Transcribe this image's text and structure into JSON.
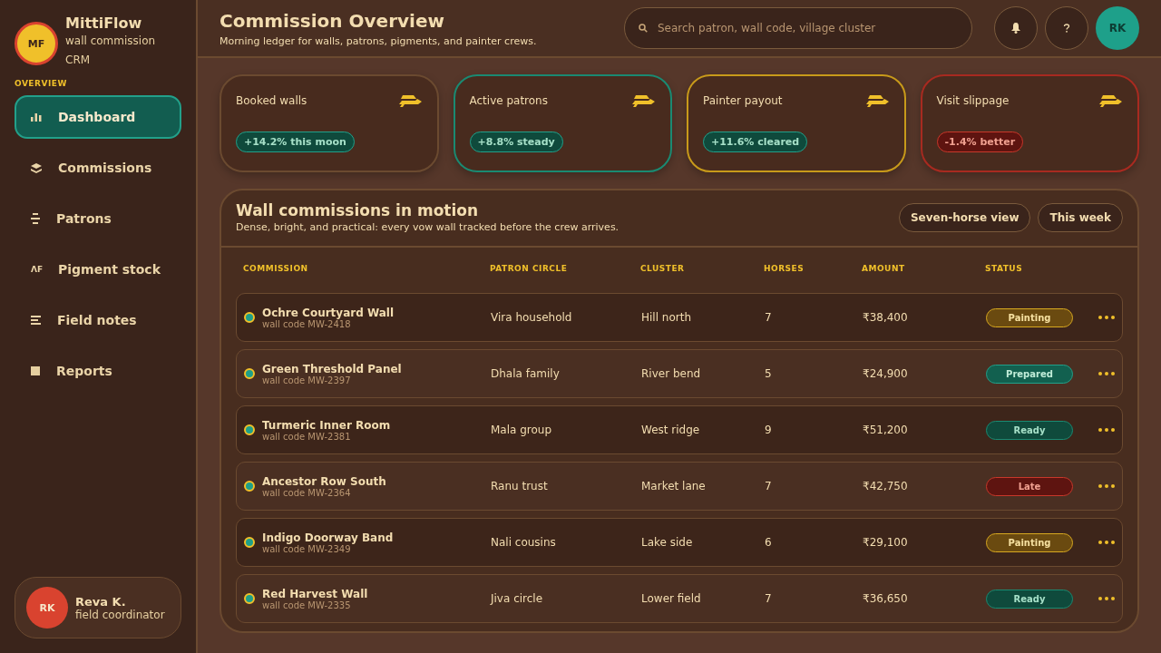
{
  "brand": {
    "initials": "MF",
    "name": "MittiFlow",
    "tagline": "wall commission CRM"
  },
  "sidebar": {
    "section": "OVERVIEW",
    "items": [
      {
        "label": "Dashboard",
        "kind": "bars",
        "selected": true
      },
      {
        "label": "Commissions",
        "kind": "layers",
        "selected": false
      },
      {
        "label": "Patrons",
        "kind": "stack",
        "selected": false
      },
      {
        "label": "Pigment stock",
        "kind": "text",
        "icon_text": "ΛF",
        "selected": false
      },
      {
        "label": "Field notes",
        "kind": "lines",
        "selected": false
      },
      {
        "label": "Reports",
        "kind": "square",
        "selected": false
      }
    ]
  },
  "user": {
    "initials": "RK",
    "name": "Reva K.",
    "role": "field coordinator"
  },
  "header": {
    "title": "Commission Overview",
    "subtitle": "Morning ledger for walls, patrons, pigments, and painter crews.",
    "search": {
      "placeholder": "Search patron, wall code, village cluster"
    },
    "avatar": "RK"
  },
  "stats": [
    {
      "label": "Booked walls",
      "badge": "+14.2% this moon",
      "kind": "neutral"
    },
    {
      "label": "Active patrons",
      "badge": "+8.8% steady",
      "kind": "teal"
    },
    {
      "label": "Painter payout",
      "badge": "+11.6% cleared",
      "kind": "gold"
    },
    {
      "label": "Visit slippage",
      "badge": "-1.4% better",
      "kind": "red"
    }
  ],
  "panel": {
    "title": "Wall commissions in motion",
    "subtitle": "Dense, bright, and practical: every vow wall tracked before the crew arrives.",
    "buttons": [
      "Seven-horse view",
      "This week"
    ]
  },
  "table": {
    "columns": [
      "COMMISSION",
      "PATRON CIRCLE",
      "CLUSTER",
      "HORSES",
      "AMOUNT",
      "STATUS"
    ],
    "rows": [
      {
        "name": "Ochre Courtyard Wall",
        "code": "wall code MW-2418",
        "patron": "Vira household",
        "cluster": "Hill north",
        "horses": "7",
        "amount": "₹38,400",
        "status": "Painting",
        "kind": "painting"
      },
      {
        "name": "Green Threshold Panel",
        "code": "wall code MW-2397",
        "patron": "Dhala family",
        "cluster": "River bend",
        "horses": "5",
        "amount": "₹24,900",
        "status": "Prepared",
        "kind": "prepared"
      },
      {
        "name": "Turmeric Inner Room",
        "code": "wall code MW-2381",
        "patron": "Mala group",
        "cluster": "West ridge",
        "horses": "9",
        "amount": "₹51,200",
        "status": "Ready",
        "kind": "ready"
      },
      {
        "name": "Ancestor Row South",
        "code": "wall code MW-2364",
        "patron": "Ranu trust",
        "cluster": "Market lane",
        "horses": "7",
        "amount": "₹42,750",
        "status": "Late",
        "kind": "late"
      },
      {
        "name": "Indigo Doorway Band",
        "code": "wall code MW-2349",
        "patron": "Nali cousins",
        "cluster": "Lake side",
        "horses": "6",
        "amount": "₹29,100",
        "status": "Painting",
        "kind": "painting"
      },
      {
        "name": "Red Harvest Wall",
        "code": "wall code MW-2335",
        "patron": "Jiva circle",
        "cluster": "Lower field",
        "horses": "7",
        "amount": "₹36,650",
        "status": "Ready",
        "kind": "ready"
      }
    ]
  }
}
